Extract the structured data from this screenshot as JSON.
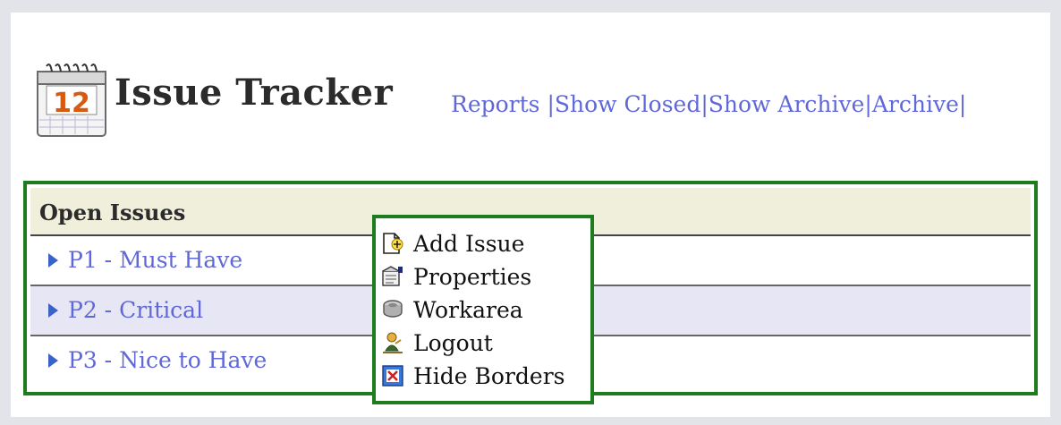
{
  "header": {
    "title": "Issue Tracker",
    "calendar_day": "12"
  },
  "nav": {
    "items": [
      "Reports",
      "Show Closed",
      "Show Archive",
      "Archive"
    ],
    "separator": "|"
  },
  "panel": {
    "heading": "Open Issues",
    "rows": [
      {
        "label": "P1 - Must Have"
      },
      {
        "label": "P2 - Critical"
      },
      {
        "label": "P3 - Nice to Have"
      }
    ]
  },
  "context_menu": {
    "items": [
      {
        "label": "Add Issue",
        "icon": "add-document-icon"
      },
      {
        "label": "Properties",
        "icon": "properties-icon"
      },
      {
        "label": "Workarea",
        "icon": "workarea-icon"
      },
      {
        "label": "Logout",
        "icon": "logout-icon"
      },
      {
        "label": "Hide Borders",
        "icon": "hide-borders-icon"
      }
    ]
  },
  "colors": {
    "link": "#6068d8",
    "border": "#1e7b1e",
    "header_bg": "#efefdc",
    "alt_row_bg": "#e6e6f4"
  }
}
